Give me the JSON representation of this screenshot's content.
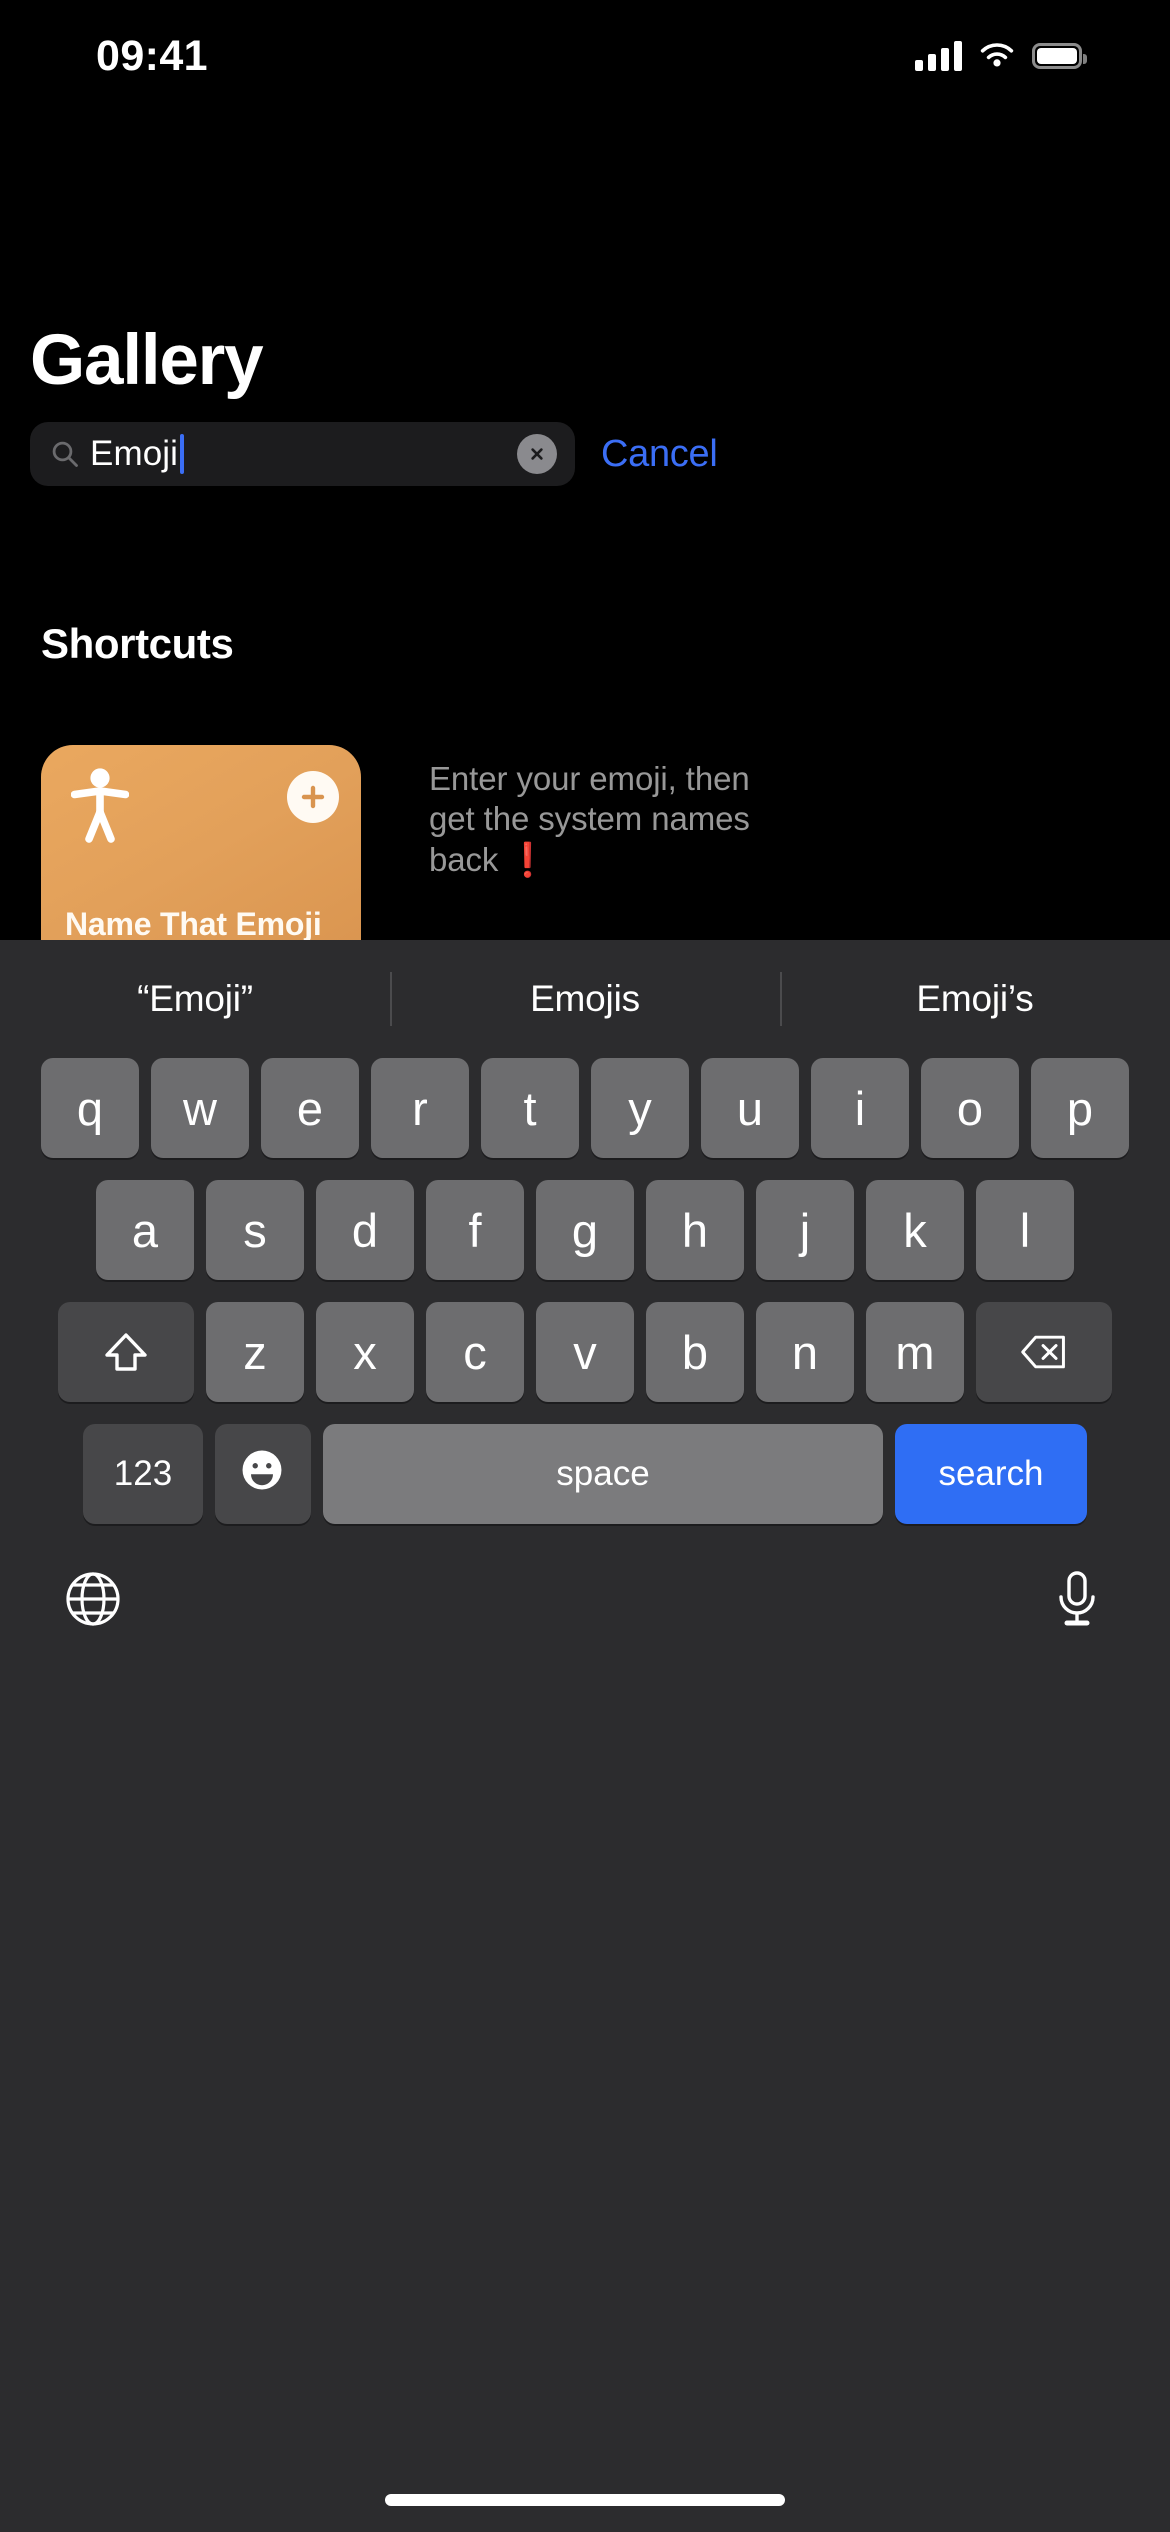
{
  "status_bar": {
    "time": "09:41",
    "cellular_icon": "signal-bars-icon",
    "wifi_icon": "wifi-icon",
    "battery_icon": "battery-full-icon"
  },
  "header": {
    "title": "Gallery"
  },
  "search": {
    "icon": "search-icon",
    "value": "Emoji",
    "placeholder": "Search",
    "clear_icon": "clear-circle-icon",
    "cancel_label": "Cancel"
  },
  "results": {
    "section_title": "Shortcuts",
    "items": [
      {
        "name": "Name That Emoji",
        "glyph_icon": "accessibility-person-icon",
        "add_icon": "plus-icon",
        "card_color": "#e2a05a",
        "description_line_1": "Enter your emoji, then",
        "description_line_2": "get the system names",
        "description_line_3": "back",
        "description_emoji": "❗"
      }
    ]
  },
  "keyboard": {
    "suggestions": [
      "“Emoji”",
      "Emojis",
      "Emoji’s"
    ],
    "row_1": [
      "q",
      "w",
      "e",
      "r",
      "t",
      "y",
      "u",
      "i",
      "o",
      "p"
    ],
    "row_2": [
      "a",
      "s",
      "d",
      "f",
      "g",
      "h",
      "j",
      "k",
      "l"
    ],
    "row_3_letters": [
      "z",
      "x",
      "c",
      "v",
      "b",
      "n",
      "m"
    ],
    "shift_icon": "shift-up-arrow-icon",
    "delete_icon": "backspace-delete-icon",
    "numeric_label": "123",
    "emoji_icon": "smiley-face-icon",
    "space_label": "space",
    "return_label": "search",
    "return_color": "#2f6ef4",
    "globe_icon": "globe-language-icon",
    "dictation_icon": "microphone-icon"
  },
  "home_indicator": "home-indicator-bar"
}
